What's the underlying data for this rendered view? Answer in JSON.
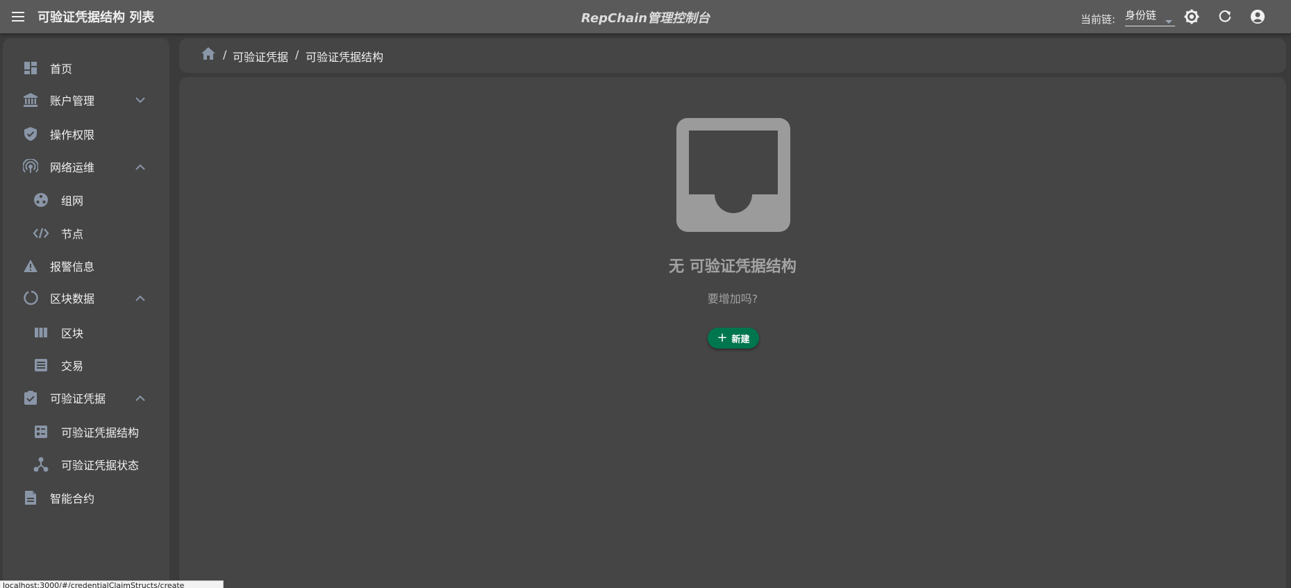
{
  "appbar": {
    "page_heading": "可验证凭据结构 列表",
    "app_title": "RepChain管理控制台",
    "chain_label": "当前链:",
    "chain_value": "身份链"
  },
  "sidebar": {
    "items": [
      {
        "label": "首页",
        "icon": "dashboard-icon"
      },
      {
        "label": "账户管理",
        "icon": "bank-icon",
        "expanded": false
      },
      {
        "label": "操作权限",
        "icon": "shield-check-icon"
      },
      {
        "label": "网络运维",
        "icon": "broadcast-icon",
        "expanded": true
      },
      {
        "label": "组网",
        "icon": "network-icon",
        "sub": true
      },
      {
        "label": "节点",
        "icon": "code-icon",
        "sub": true
      },
      {
        "label": "报警信息",
        "icon": "warning-icon"
      },
      {
        "label": "区块数据",
        "icon": "progress-ring-icon",
        "expanded": true
      },
      {
        "label": "区块",
        "icon": "columns-icon",
        "sub": true
      },
      {
        "label": "交易",
        "icon": "list-box-icon",
        "sub": true
      },
      {
        "label": "可验证凭据",
        "icon": "clipboard-check-icon",
        "expanded": true
      },
      {
        "label": "可验证凭据结构",
        "icon": "form-list-icon",
        "sub": true
      },
      {
        "label": "可验证凭据状态",
        "icon": "hub-icon",
        "sub": true
      },
      {
        "label": "智能合约",
        "icon": "document-icon"
      }
    ]
  },
  "breadcrumb": {
    "items": [
      "可验证凭据",
      "可验证凭据结构"
    ]
  },
  "empty_state": {
    "title": "无 可验证凭据结构",
    "subtitle": "要增加吗?",
    "button_label": "新建"
  },
  "status_url": "localhost:3000/#/credentialClaimStructs/create",
  "colors": {
    "appbar": "#5a5a5a",
    "panel": "#454545",
    "background": "#3b3b3b",
    "icon": "#8a96a8",
    "primary_button": "#00764e"
  }
}
